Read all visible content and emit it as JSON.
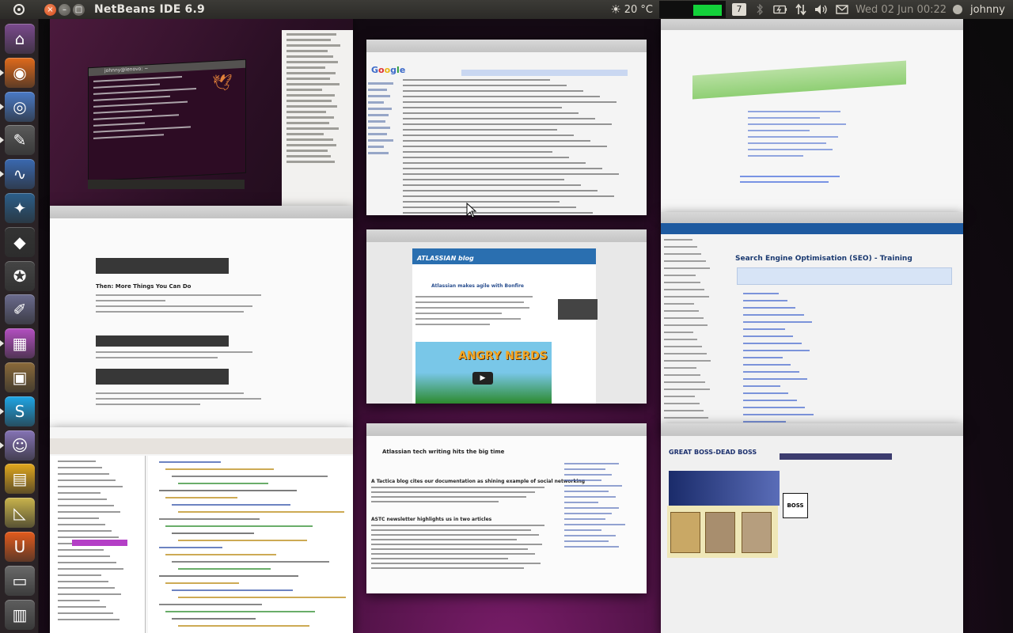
{
  "topbar": {
    "app_title": "NetBeans IDE 6.9",
    "weather_temp": "20 °C",
    "workspace_number": "7",
    "clock": "Wed 02 Jun 00:22",
    "username": "johnny"
  },
  "window_controls": {
    "close_glyph": "×",
    "minimize_glyph": "–",
    "maximize_glyph": "□"
  },
  "launcher": {
    "items": [
      {
        "name": "home-folder",
        "icon": "folder-icon",
        "color": "#7b4a8e",
        "glyph": "⌂"
      },
      {
        "name": "firefox",
        "icon": "firefox-icon",
        "color": "#e06a1b",
        "glyph": "◉"
      },
      {
        "name": "chromium",
        "icon": "chromium-icon",
        "color": "#4a7ac6",
        "glyph": "◎"
      },
      {
        "name": "text-editor",
        "icon": "text-editor-icon",
        "color": "#5b5b5b",
        "glyph": "✎"
      },
      {
        "name": "system-monitor",
        "icon": "monitor-icon",
        "color": "#3a69b0",
        "glyph": "∿"
      },
      {
        "name": "shutter",
        "icon": "camera-icon",
        "color": "#2b5f8a",
        "glyph": "✦"
      },
      {
        "name": "inkscape",
        "icon": "inkscape-icon",
        "color": "#333",
        "glyph": "◆"
      },
      {
        "name": "gimp",
        "icon": "gimp-icon",
        "color": "#454545",
        "glyph": "✪"
      },
      {
        "name": "drawing-app",
        "icon": "drawing-icon",
        "color": "#6b6b8e",
        "glyph": "✐"
      },
      {
        "name": "screen-recorder",
        "icon": "recorder-icon",
        "color": "#b34fc1",
        "glyph": "▦"
      },
      {
        "name": "package-manager",
        "icon": "package-icon",
        "color": "#8a6a3a",
        "glyph": "▣"
      },
      {
        "name": "skype",
        "icon": "skype-icon",
        "color": "#1ea6e6",
        "glyph": "S"
      },
      {
        "name": "pidgin",
        "icon": "chat-icon",
        "color": "#8573b5",
        "glyph": "☺"
      },
      {
        "name": "workspace-switcher",
        "icon": "workspaces-icon",
        "color": "#e2a81d",
        "glyph": "▤"
      },
      {
        "name": "presentation",
        "icon": "presentation-icon",
        "color": "#c9b44c",
        "glyph": "◺"
      },
      {
        "name": "ubuntu-software",
        "icon": "software-center-icon",
        "color": "#e45b1c",
        "glyph": "U"
      },
      {
        "name": "removable-drive",
        "icon": "drive-icon",
        "color": "#6a6a6a",
        "glyph": "▭"
      },
      {
        "name": "trash",
        "icon": "trash-icon",
        "color": "#5e5e5e",
        "glyph": "▥"
      }
    ]
  },
  "workspaces": {
    "ws1": {
      "label": "desktop-terminal",
      "terminal_title": "johnny@lenovo: ~"
    },
    "ws2": {
      "label": "gmail",
      "logo": [
        "G",
        "o",
        "o",
        "g",
        "l",
        "e"
      ]
    },
    "ws3": {
      "label": "confluence-page"
    },
    "ws4": {
      "label": "git-wiki-page",
      "heading": "Then: More Things You Can Do"
    },
    "ws5": {
      "label": "atlassian-blog",
      "header": "ATLASSIAN blog",
      "post_title": "Atlassian makes agile with Bonfire",
      "angry_text": "ANGRY NERDS"
    },
    "ws6": {
      "label": "seo-wiki",
      "page_title": "Search Engine Optimisation (SEO) - Training"
    },
    "ws7": {
      "label": "netbeans-editor"
    },
    "ws8": {
      "label": "news-blog",
      "headline1": "Atlassian tech writing hits the big time",
      "headline2": "A Tactica blog cites our documentation as shining example of social networking",
      "headline3": "ASTC newsletter highlights us in two articles"
    },
    "ws9": {
      "label": "boss-site",
      "page_title": "GREAT BOSS-DEAD BOSS",
      "logo_text": "BOSS"
    }
  },
  "colors": {
    "indicator_green": "#13d13a",
    "launcher_bg": "#2d2628",
    "panel_bg": "#3c3b37",
    "accent_purple": "#7a1d6a"
  }
}
